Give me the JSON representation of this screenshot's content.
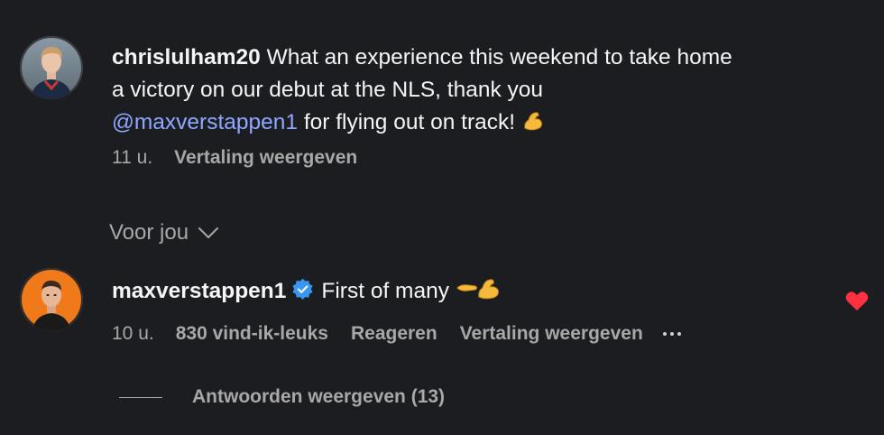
{
  "comments": [
    {
      "username": "chrislulham20",
      "text_line1": "What an experience this weekend to take home",
      "text_line2": "a victory on our debut at the NLS, thank you",
      "mention": "@maxverstappen1",
      "text_line3_after_mention": "for flying out on track!",
      "emoji": "flexed-biceps",
      "time": "11 u.",
      "translate_label": "Vertaling weergeven"
    },
    {
      "username": "maxverstappen1",
      "verified": true,
      "text": "First of many",
      "emoji": "pointing-hand-and-flexed-biceps",
      "time": "10 u.",
      "likes_label": "830 vind-ik-leuks",
      "reply_label": "Reageren",
      "translate_label": "Vertaling weergeven",
      "liked": true,
      "view_replies_label": "Antwoorden weergeven (13)"
    }
  ],
  "filter": {
    "label": "Voor jou"
  },
  "colors": {
    "background": "#1c1d20",
    "mention": "#8ea8ff",
    "verified": "#3897f0",
    "heart": "#ff3040",
    "secondary_text": "#a8a8a8"
  }
}
